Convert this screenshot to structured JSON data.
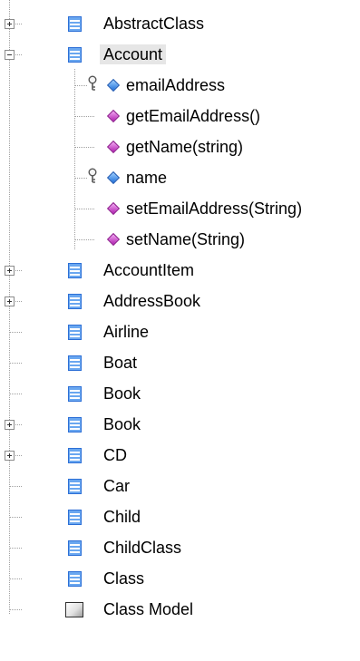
{
  "tree": {
    "items": [
      {
        "label": "AbstractClass",
        "kind": "class",
        "level": 0,
        "toggle": "plus"
      },
      {
        "label": "Account",
        "kind": "class",
        "level": 0,
        "toggle": "minus",
        "selected": true
      },
      {
        "label": "emailAddress",
        "kind": "attribute",
        "level": 1,
        "key": true
      },
      {
        "label": "getEmailAddress()",
        "kind": "operation",
        "level": 1
      },
      {
        "label": "getName(string)",
        "kind": "operation",
        "level": 1
      },
      {
        "label": "name",
        "kind": "attribute",
        "level": 1,
        "key": true
      },
      {
        "label": "setEmailAddress(String)",
        "kind": "operation",
        "level": 1
      },
      {
        "label": "setName(String)",
        "kind": "operation",
        "level": 1
      },
      {
        "label": "AccountItem",
        "kind": "class",
        "level": 0,
        "toggle": "plus"
      },
      {
        "label": "AddressBook",
        "kind": "class",
        "level": 0,
        "toggle": "plus"
      },
      {
        "label": "Airline",
        "kind": "class",
        "level": 0
      },
      {
        "label": "Boat",
        "kind": "class",
        "level": 0
      },
      {
        "label": "Book",
        "kind": "class",
        "level": 0
      },
      {
        "label": "Book",
        "kind": "class",
        "level": 0,
        "toggle": "plus"
      },
      {
        "label": "CD",
        "kind": "class",
        "level": 0,
        "toggle": "plus"
      },
      {
        "label": "Car",
        "kind": "class",
        "level": 0
      },
      {
        "label": "Child",
        "kind": "class",
        "level": 0
      },
      {
        "label": "ChildClass",
        "kind": "class",
        "level": 0
      },
      {
        "label": "Class",
        "kind": "class",
        "level": 0
      },
      {
        "label": "Class Model",
        "kind": "model",
        "level": 0
      }
    ]
  },
  "colors": {
    "class_icon_fill": "#6aa7f0",
    "class_icon_border": "#2c6fd6",
    "attribute_diamond": "#1f6fd8",
    "operation_diamond": "#b020b0",
    "selection_background": "#e6e6e6",
    "tree_lines": "#a0a0a0"
  },
  "icons": {
    "class": "class-icon",
    "model": "class-model-icon",
    "attribute": "attribute-diamond-icon",
    "operation": "operation-diamond-icon",
    "key": "key-icon"
  }
}
